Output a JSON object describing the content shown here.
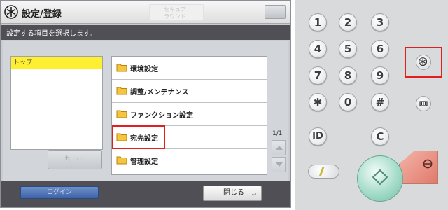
{
  "screen": {
    "title": "設定/登録",
    "secure_logo": {
      "line1": "セキュア",
      "line2": "ラウンド"
    },
    "instruction": "設定する項目を選択します。",
    "tree": {
      "items": [
        {
          "label": "トップ",
          "selected": true
        }
      ]
    },
    "list": {
      "items": [
        {
          "label": "環境設定",
          "highlighted": false
        },
        {
          "label": "調整/メンテナンス",
          "highlighted": false
        },
        {
          "label": "ファンクション設定",
          "highlighted": false
        },
        {
          "label": "宛先設定",
          "highlighted": true
        },
        {
          "label": "管理設定",
          "highlighted": false
        }
      ]
    },
    "page_indicator": "1/1",
    "login_label": "ログイン",
    "close_label": "閉じる"
  },
  "keypad": {
    "keys": [
      "1",
      "2",
      "3",
      "4",
      "5",
      "6",
      "7",
      "8",
      "9",
      "✱",
      "0",
      "#"
    ],
    "id_label": "ID",
    "clear_label": "C",
    "highlighted_key": "settings"
  },
  "colors": {
    "selected_item": "#ffef31",
    "highlight_box": "#e02020",
    "dark_bar": "#4f4f55",
    "login_button": "#4a6fb2",
    "start_button": "#a5dcc9",
    "stop_button": "#e88c7c"
  }
}
